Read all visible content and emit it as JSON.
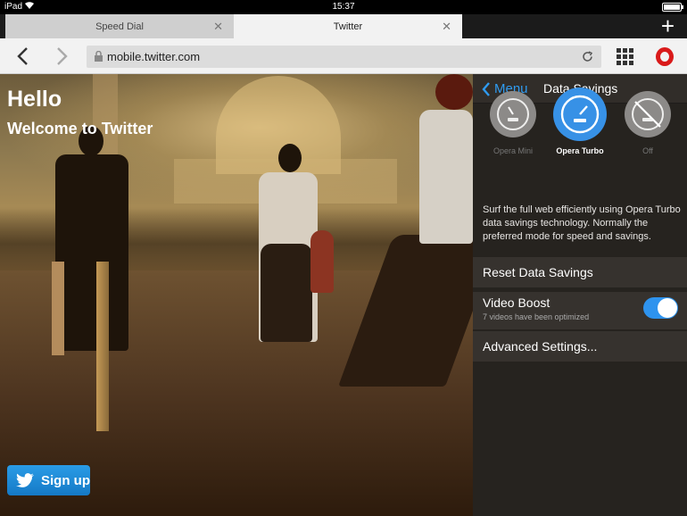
{
  "status": {
    "device": "iPad",
    "time": "15:37"
  },
  "tabs": [
    {
      "label": "Speed Dial",
      "active": false
    },
    {
      "label": "Twitter",
      "active": true
    }
  ],
  "toolbar": {
    "url": "mobile.twitter.com"
  },
  "page": {
    "hello": "Hello",
    "welcome": "Welcome to Twitter",
    "signup": "Sign up"
  },
  "panel": {
    "back_label": "Menu",
    "title": "Data Savings",
    "modes": [
      {
        "label": "Opera Mini",
        "selected": false
      },
      {
        "label": "Opera Turbo",
        "selected": true
      },
      {
        "label": "Off",
        "selected": false
      }
    ],
    "description": "Surf the full web efficiently using Opera Turbo data savings technology. Normally the preferred mode for speed and savings.",
    "reset": "Reset Data Savings",
    "video_boost": {
      "label": "Video Boost",
      "sub": "7 videos have been optimized",
      "enabled": true
    },
    "advanced": "Advanced Settings..."
  },
  "colors": {
    "accent": "#2f9bf0",
    "opera_red": "#d91a1a",
    "twitter_blue": "#2a9ce6"
  }
}
